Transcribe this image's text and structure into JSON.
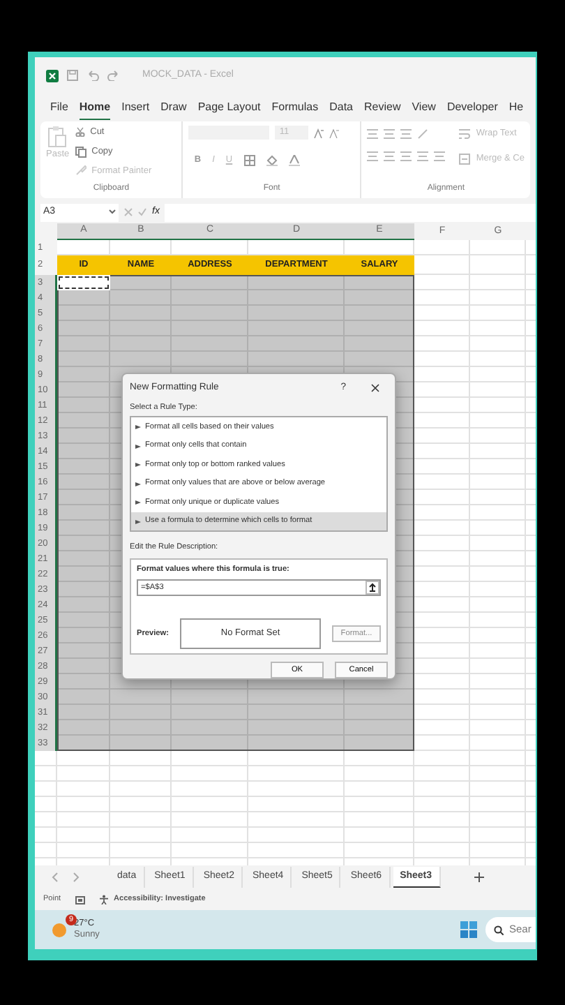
{
  "title_bar": {
    "title": "MOCK_DATA - Excel"
  },
  "menu": [
    {
      "label": "File",
      "selected": false
    },
    {
      "label": "Home",
      "selected": true
    },
    {
      "label": "Insert",
      "selected": false
    },
    {
      "label": "Draw",
      "selected": false
    },
    {
      "label": "Page Layout",
      "selected": false
    },
    {
      "label": "Formulas",
      "selected": false
    },
    {
      "label": "Data",
      "selected": false
    },
    {
      "label": "Review",
      "selected": false
    },
    {
      "label": "View",
      "selected": false
    },
    {
      "label": "Developer",
      "selected": false
    },
    {
      "label": "He",
      "selected": false
    }
  ],
  "ribbon": {
    "clipboard": {
      "paste": "Paste",
      "cut": "Cut",
      "copy": "Copy",
      "format_painter": "Format Painter",
      "label": "Clipboard"
    },
    "font": {
      "size": "11",
      "bold": "B",
      "italic": "I",
      "underline": "U",
      "label": "Font"
    },
    "alignment": {
      "wrap_text": "Wrap Text",
      "merge": "Merge & Ce",
      "label": "Alignment"
    }
  },
  "formula_bar": {
    "name_box": "A3",
    "function_label": "fx"
  },
  "sheet": {
    "columns": [
      {
        "label": "A",
        "selected": true
      },
      {
        "label": "B",
        "selected": true
      },
      {
        "label": "C",
        "selected": true
      },
      {
        "label": "D",
        "selected": true
      },
      {
        "label": "E",
        "selected": true
      },
      {
        "label": "F",
        "selected": false
      },
      {
        "label": "G",
        "selected": false
      }
    ],
    "rows": [
      {
        "label": "1",
        "selected": false
      },
      {
        "label": "2",
        "selected": false,
        "cells": [
          "ID",
          "NAME",
          "ADDRESS",
          "DEPARTMENT",
          "SALARY"
        ]
      },
      {
        "label": "3",
        "selected": true
      },
      {
        "label": "4",
        "selected": true
      },
      {
        "label": "5",
        "selected": true
      },
      {
        "label": "6",
        "selected": true
      },
      {
        "label": "7",
        "selected": true
      },
      {
        "label": "8",
        "selected": true
      },
      {
        "label": "9",
        "selected": true
      },
      {
        "label": "10",
        "selected": true
      },
      {
        "label": "11",
        "selected": true
      },
      {
        "label": "12",
        "selected": true
      },
      {
        "label": "13",
        "selected": true
      },
      {
        "label": "14",
        "selected": true
      },
      {
        "label": "15",
        "selected": true
      },
      {
        "label": "16",
        "selected": true
      },
      {
        "label": "17",
        "selected": true
      },
      {
        "label": "18",
        "selected": true
      },
      {
        "label": "19",
        "selected": true
      },
      {
        "label": "20",
        "selected": true
      },
      {
        "label": "21",
        "selected": true
      },
      {
        "label": "22",
        "selected": true
      },
      {
        "label": "23",
        "selected": true
      },
      {
        "label": "24",
        "selected": true
      },
      {
        "label": "25",
        "selected": true
      },
      {
        "label": "26",
        "selected": true
      },
      {
        "label": "27",
        "selected": true
      },
      {
        "label": "28",
        "selected": true
      },
      {
        "label": "29",
        "selected": true
      },
      {
        "label": "30",
        "selected": true
      },
      {
        "label": "31",
        "selected": true
      },
      {
        "label": "32",
        "selected": true
      },
      {
        "label": "33",
        "selected": true
      }
    ]
  },
  "dialog": {
    "title": "New Formatting Rule",
    "help": "?",
    "rule_type_label": "Select a Rule Type:",
    "rule_types": [
      {
        "label": "Format all cells based on their values",
        "selected": false
      },
      {
        "label": "Format only cells that contain",
        "selected": false
      },
      {
        "label": "Format only top or bottom ranked values",
        "selected": false
      },
      {
        "label": "Format only values that are above or below average",
        "selected": false
      },
      {
        "label": "Format only unique or duplicate values",
        "selected": false
      },
      {
        "label": "Use a formula to determine which cells to format",
        "selected": true
      }
    ],
    "description_label": "Edit the Rule Description:",
    "formula_label": "Format values where this formula is true:",
    "formula_value": "=$A$3",
    "preview_label": "Preview:",
    "preview_text": "No Format Set",
    "format_button": "Format...",
    "ok_button": "OK",
    "cancel_button": "Cancel"
  },
  "sheet_tabs": [
    {
      "label": "data",
      "selected": false
    },
    {
      "label": "Sheet1",
      "selected": false
    },
    {
      "label": "Sheet2",
      "selected": false
    },
    {
      "label": "Sheet4",
      "selected": false
    },
    {
      "label": "Sheet5",
      "selected": false
    },
    {
      "label": "Sheet6",
      "selected": false
    },
    {
      "label": "Sheet3",
      "selected": true
    }
  ],
  "status_bar": {
    "mode": "Point",
    "accessibility": "Accessibility: Investigate"
  },
  "taskbar": {
    "weather": {
      "badge": "9",
      "temperature": "27°C",
      "condition": "Sunny"
    },
    "search": {
      "placeholder": "Sear"
    }
  }
}
